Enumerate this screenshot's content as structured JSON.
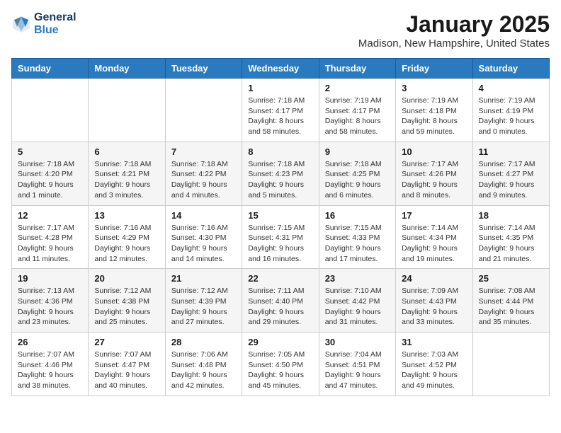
{
  "header": {
    "logo_general": "General",
    "logo_blue": "Blue",
    "month": "January 2025",
    "location": "Madison, New Hampshire, United States"
  },
  "weekdays": [
    "Sunday",
    "Monday",
    "Tuesday",
    "Wednesday",
    "Thursday",
    "Friday",
    "Saturday"
  ],
  "weeks": [
    [
      {
        "day": "",
        "info": ""
      },
      {
        "day": "",
        "info": ""
      },
      {
        "day": "",
        "info": ""
      },
      {
        "day": "1",
        "info": "Sunrise: 7:18 AM\nSunset: 4:17 PM\nDaylight: 8 hours and 58 minutes."
      },
      {
        "day": "2",
        "info": "Sunrise: 7:19 AM\nSunset: 4:17 PM\nDaylight: 8 hours and 58 minutes."
      },
      {
        "day": "3",
        "info": "Sunrise: 7:19 AM\nSunset: 4:18 PM\nDaylight: 8 hours and 59 minutes."
      },
      {
        "day": "4",
        "info": "Sunrise: 7:19 AM\nSunset: 4:19 PM\nDaylight: 9 hours and 0 minutes."
      }
    ],
    [
      {
        "day": "5",
        "info": "Sunrise: 7:18 AM\nSunset: 4:20 PM\nDaylight: 9 hours and 1 minute."
      },
      {
        "day": "6",
        "info": "Sunrise: 7:18 AM\nSunset: 4:21 PM\nDaylight: 9 hours and 3 minutes."
      },
      {
        "day": "7",
        "info": "Sunrise: 7:18 AM\nSunset: 4:22 PM\nDaylight: 9 hours and 4 minutes."
      },
      {
        "day": "8",
        "info": "Sunrise: 7:18 AM\nSunset: 4:23 PM\nDaylight: 9 hours and 5 minutes."
      },
      {
        "day": "9",
        "info": "Sunrise: 7:18 AM\nSunset: 4:25 PM\nDaylight: 9 hours and 6 minutes."
      },
      {
        "day": "10",
        "info": "Sunrise: 7:17 AM\nSunset: 4:26 PM\nDaylight: 9 hours and 8 minutes."
      },
      {
        "day": "11",
        "info": "Sunrise: 7:17 AM\nSunset: 4:27 PM\nDaylight: 9 hours and 9 minutes."
      }
    ],
    [
      {
        "day": "12",
        "info": "Sunrise: 7:17 AM\nSunset: 4:28 PM\nDaylight: 9 hours and 11 minutes."
      },
      {
        "day": "13",
        "info": "Sunrise: 7:16 AM\nSunset: 4:29 PM\nDaylight: 9 hours and 12 minutes."
      },
      {
        "day": "14",
        "info": "Sunrise: 7:16 AM\nSunset: 4:30 PM\nDaylight: 9 hours and 14 minutes."
      },
      {
        "day": "15",
        "info": "Sunrise: 7:15 AM\nSunset: 4:31 PM\nDaylight: 9 hours and 16 minutes."
      },
      {
        "day": "16",
        "info": "Sunrise: 7:15 AM\nSunset: 4:33 PM\nDaylight: 9 hours and 17 minutes."
      },
      {
        "day": "17",
        "info": "Sunrise: 7:14 AM\nSunset: 4:34 PM\nDaylight: 9 hours and 19 minutes."
      },
      {
        "day": "18",
        "info": "Sunrise: 7:14 AM\nSunset: 4:35 PM\nDaylight: 9 hours and 21 minutes."
      }
    ],
    [
      {
        "day": "19",
        "info": "Sunrise: 7:13 AM\nSunset: 4:36 PM\nDaylight: 9 hours and 23 minutes."
      },
      {
        "day": "20",
        "info": "Sunrise: 7:12 AM\nSunset: 4:38 PM\nDaylight: 9 hours and 25 minutes."
      },
      {
        "day": "21",
        "info": "Sunrise: 7:12 AM\nSunset: 4:39 PM\nDaylight: 9 hours and 27 minutes."
      },
      {
        "day": "22",
        "info": "Sunrise: 7:11 AM\nSunset: 4:40 PM\nDaylight: 9 hours and 29 minutes."
      },
      {
        "day": "23",
        "info": "Sunrise: 7:10 AM\nSunset: 4:42 PM\nDaylight: 9 hours and 31 minutes."
      },
      {
        "day": "24",
        "info": "Sunrise: 7:09 AM\nSunset: 4:43 PM\nDaylight: 9 hours and 33 minutes."
      },
      {
        "day": "25",
        "info": "Sunrise: 7:08 AM\nSunset: 4:44 PM\nDaylight: 9 hours and 35 minutes."
      }
    ],
    [
      {
        "day": "26",
        "info": "Sunrise: 7:07 AM\nSunset: 4:46 PM\nDaylight: 9 hours and 38 minutes."
      },
      {
        "day": "27",
        "info": "Sunrise: 7:07 AM\nSunset: 4:47 PM\nDaylight: 9 hours and 40 minutes."
      },
      {
        "day": "28",
        "info": "Sunrise: 7:06 AM\nSunset: 4:48 PM\nDaylight: 9 hours and 42 minutes."
      },
      {
        "day": "29",
        "info": "Sunrise: 7:05 AM\nSunset: 4:50 PM\nDaylight: 9 hours and 45 minutes."
      },
      {
        "day": "30",
        "info": "Sunrise: 7:04 AM\nSunset: 4:51 PM\nDaylight: 9 hours and 47 minutes."
      },
      {
        "day": "31",
        "info": "Sunrise: 7:03 AM\nSunset: 4:52 PM\nDaylight: 9 hours and 49 minutes."
      },
      {
        "day": "",
        "info": ""
      }
    ]
  ]
}
